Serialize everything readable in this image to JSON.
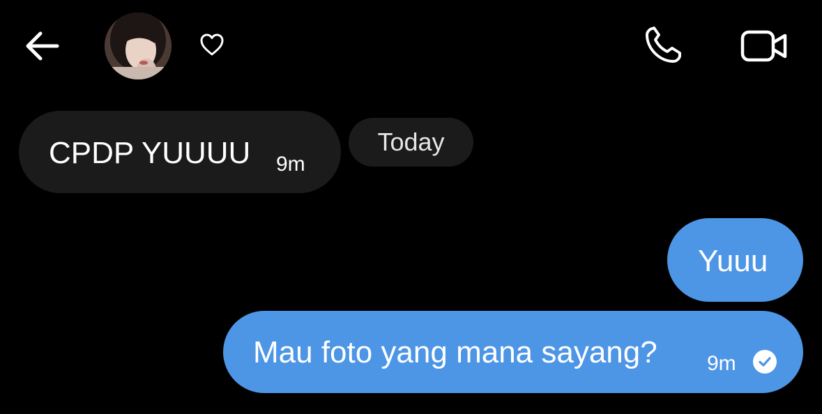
{
  "header": {
    "back_icon": "arrow-left-icon",
    "avatar_alt": "contact avatar",
    "heart_icon": "heart-outline-icon",
    "call_icon": "phone-icon",
    "video_icon": "video-camera-icon"
  },
  "date_separator": "Today",
  "messages": [
    {
      "direction": "incoming",
      "text": "CPDP YUUUU",
      "time": "9m"
    },
    {
      "direction": "outgoing",
      "text": "Yuuu"
    },
    {
      "direction": "outgoing",
      "text": "Mau foto yang mana sayang?",
      "time": "9m",
      "status_icon": "read-check-icon"
    }
  ],
  "colors": {
    "background": "#000000",
    "incoming_bubble": "#1b1b1c",
    "outgoing_bubble": "#4d95e5",
    "text": "#ffffff"
  }
}
